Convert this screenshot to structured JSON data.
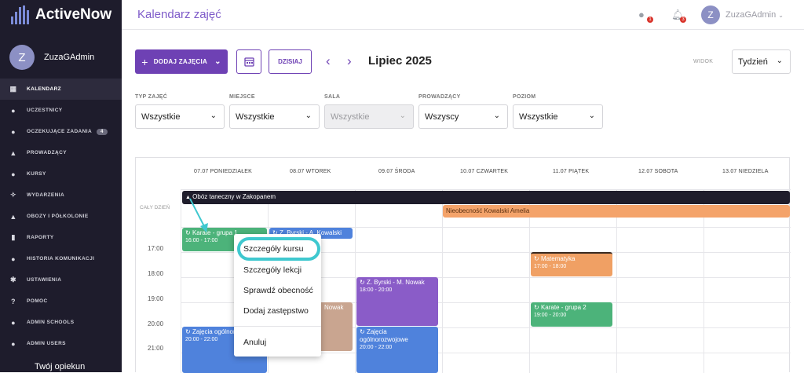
{
  "app": {
    "name": "ActiveNow"
  },
  "user": {
    "name": "ZuzaGAdmin",
    "initial": "Z"
  },
  "sidebar": {
    "items": [
      {
        "label": "KALENDARZ",
        "icon": "calendar-icon"
      },
      {
        "label": "UCZESTNICY",
        "icon": "person-icon"
      },
      {
        "label": "OCZEKUJĄCE ZADANIA",
        "icon": "person-icon",
        "badge": "4"
      },
      {
        "label": "PROWADZĄCY",
        "icon": "graduation-cap-icon"
      },
      {
        "label": "KURSY",
        "icon": "group-icon"
      },
      {
        "label": "WYDARZENIA",
        "icon": "party-icon"
      },
      {
        "label": "OBOZY I PÓŁKOLONIE",
        "icon": "tent-icon"
      },
      {
        "label": "RAPORTY",
        "icon": "chart-icon"
      },
      {
        "label": "HISTORIA KOMUNIKACJI",
        "icon": "chat-icon"
      },
      {
        "label": "USTAWIENIA",
        "icon": "gear-icon"
      },
      {
        "label": "POMOC",
        "icon": "help-icon"
      },
      {
        "label": "ADMIN SCHOOLS",
        "icon": "person-icon"
      },
      {
        "label": "ADMIN USERS",
        "icon": "person-icon"
      }
    ],
    "opiekun": "Twój opiekun"
  },
  "header": {
    "title": "Kalendarz zajęć",
    "messages_badge": "1",
    "notifications_badge": "3",
    "user_name": "ZuzaGAdmin"
  },
  "toolbar": {
    "add_label": "DODAJ ZAJĘCIA",
    "today_label": "DZISIAJ",
    "month": "Lipiec 2025",
    "view_label": "WIDOK",
    "view_value": "Tydzień"
  },
  "filters": [
    {
      "label": "TYP ZAJĘĆ",
      "value": "Wszystkie",
      "disabled": false
    },
    {
      "label": "MIEJSCE",
      "value": "Wszystkie",
      "disabled": false
    },
    {
      "label": "SALA",
      "value": "Wszystkie",
      "disabled": true
    },
    {
      "label": "PROWADZĄCY",
      "value": "Wszyscy",
      "disabled": false
    },
    {
      "label": "POZIOM",
      "value": "Wszystkie",
      "disabled": false
    }
  ],
  "calendar": {
    "days": [
      "07.07 PONIEDZIAŁEK",
      "08.07 WTOREK",
      "09.07 ŚRODA",
      "10.07 CZWARTEK",
      "11.07 PIĄTEK",
      "12.07 SOBOTA",
      "13.07 NIEDZIELA"
    ],
    "allday_label": "CAŁY DZIEŃ",
    "hours": [
      "17:00",
      "18:00",
      "19:00",
      "20:00",
      "21:00"
    ],
    "allday_events": [
      {
        "title": "Obóz taneczny w Zakopanem",
        "color": "#1f1d2b"
      },
      {
        "title": "Nieobecność Kowalski Amelia",
        "color": "#f4a36a"
      }
    ],
    "events": [
      {
        "title": "Karate - grupa 1",
        "time": "16:00 - 17:00",
        "color": "#4cb37a"
      },
      {
        "title": "Z. Byrski - A. Kowalski",
        "time": "",
        "color": "#4f82dc"
      },
      {
        "title": "Matematyka",
        "time": "17:00 - 18:00",
        "color": "#f0a064"
      },
      {
        "title": "Z. Byrski - M. Nowak",
        "time": "18:00 - 20:00",
        "color": "#8a5cc8"
      },
      {
        "title": "Nowak",
        "time": "",
        "color": "#c9a590"
      },
      {
        "title": "Karate - grupa 2",
        "time": "19:00 - 20:00",
        "color": "#4cb37a"
      },
      {
        "title": "Zajęcia ogólnorozwojowe",
        "time": "20:00 - 22:00",
        "color": "#4f82dc"
      },
      {
        "title": "Zajęcia ogólnorozwojowe",
        "time": "20:00 - 22:00",
        "color": "#4f82dc"
      }
    ]
  },
  "context_menu": {
    "items": [
      "Szczegóły kursu",
      "Szczegóły lekcji",
      "Sprawdź obecność",
      "Dodaj zastępstwo",
      "Anuluj"
    ]
  },
  "colors": {
    "sidebar": "#1e1c2c",
    "accent": "#6e41b4",
    "highlight": "#3fc8cf"
  }
}
